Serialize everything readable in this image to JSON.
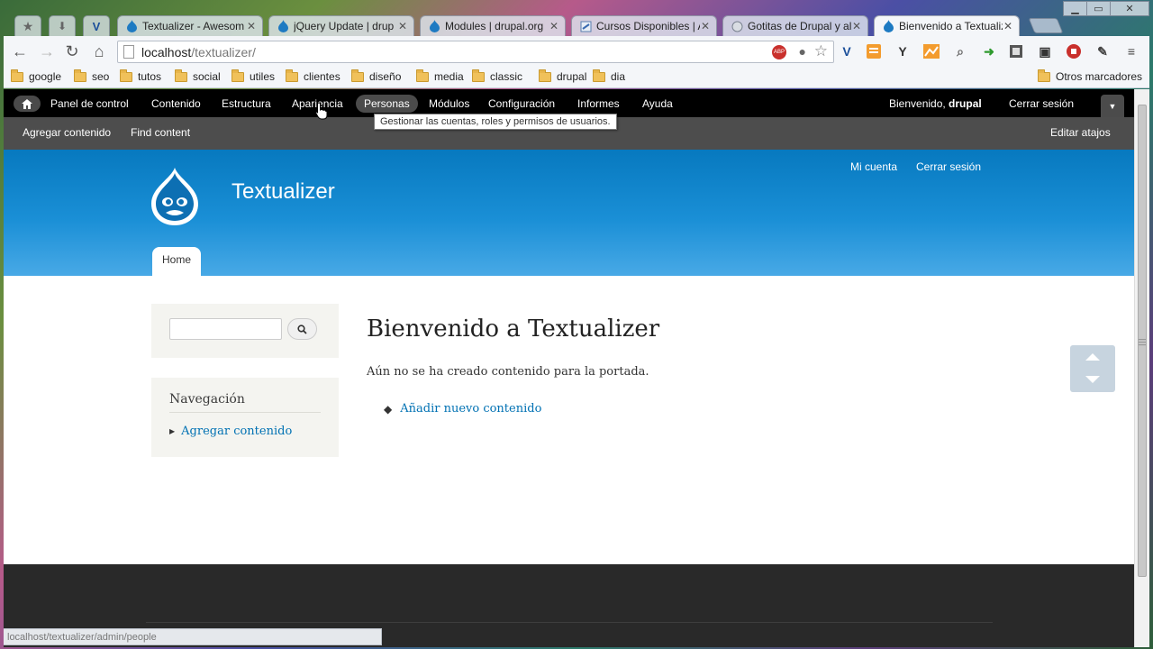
{
  "tabs": [
    {
      "title": "Textualizer - Awesom",
      "icon": "drupal-icon"
    },
    {
      "title": "jQuery Update | drup",
      "icon": "drupal-icon"
    },
    {
      "title": "Modules | drupal.org",
      "icon": "drupal-icon"
    },
    {
      "title": "Cursos Disponibles | A",
      "icon": "course-icon"
    },
    {
      "title": "Gotitas de Drupal y al",
      "icon": "globe-icon"
    },
    {
      "title": "Bienvenido a Textualiz",
      "icon": "drupal-icon",
      "active": true
    }
  ],
  "address": {
    "host": "localhost",
    "path": "/textualizer/"
  },
  "bookmarks": [
    "google",
    "seo",
    "tutos",
    "social",
    "utiles",
    "clientes",
    "diseño",
    "media",
    "classic",
    "drupal",
    "dia"
  ],
  "other_bookmarks": "Otros marcadores",
  "admin_menu": [
    "Panel de control",
    "Contenido",
    "Estructura",
    "Apariencia",
    "Personas",
    "Módulos",
    "Configuración",
    "Informes",
    "Ayuda"
  ],
  "admin_active": "Personas",
  "welcome": {
    "prefix": "Bienvenido, ",
    "user": "drupal"
  },
  "logout": "Cerrar sesión",
  "tooltip": "Gestionar las cuentas, roles y permisos de usuarios.",
  "shortcuts": [
    "Agregar contenido",
    "Find content"
  ],
  "edit_shortcuts": "Editar atajos",
  "site": {
    "name": "Textualizer",
    "account_link": "Mi cuenta",
    "logout_link": "Cerrar sesión",
    "home_tab": "Home"
  },
  "sidebar": {
    "nav_title": "Navegación",
    "nav_link": "Agregar contenido"
  },
  "main": {
    "title": "Bienvenido a Textualizer",
    "text": "Aún no se ha creado contenido para la portada.",
    "link": "Añadir nuevo contenido"
  },
  "status": "localhost/textualizer/admin/people",
  "colors": {
    "admin_bar": "#000000",
    "header_blue": "#0779bf",
    "link": "#0071b3",
    "footer": "#292929"
  }
}
